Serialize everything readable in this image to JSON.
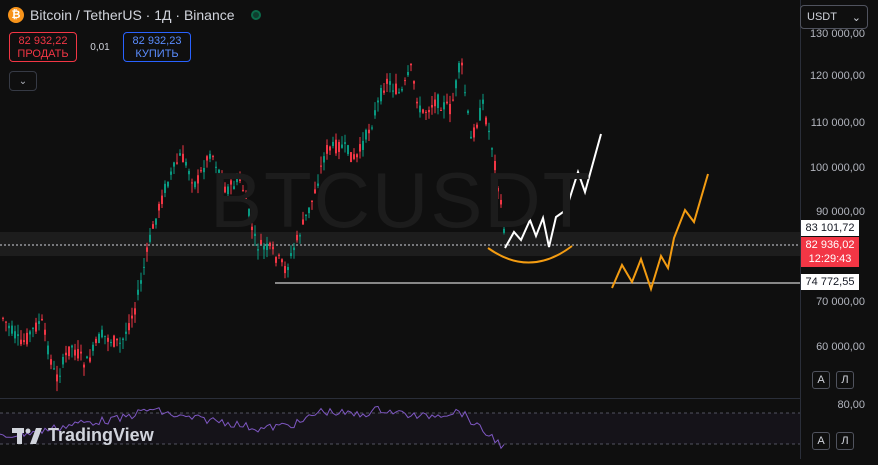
{
  "header": {
    "coin_icon": "₿",
    "title": "Bitcoin / TetherUS · 1Д · Binance"
  },
  "trade": {
    "sell_price": "82 932,22",
    "sell_label": "ПРОДАТЬ",
    "spread": "0,01",
    "buy_price": "82 932,23",
    "buy_label": "КУПИТЬ"
  },
  "currency_select": {
    "value": "USDT",
    "icon": "chevron-down-icon"
  },
  "watermark": "BTCUSDT",
  "price_axis": {
    "labels": [
      "130 000,00",
      "120 000,00",
      "110 000,00",
      "100 000,00",
      "90 000,00",
      "70 000,00",
      "60 000,00"
    ]
  },
  "price_tags": {
    "upper_level": "83 101,72",
    "current_price": "82 936,02",
    "countdown": "12:29:43",
    "lower_level": "74 772,55"
  },
  "rsi": {
    "level": "80,00"
  },
  "buttons": {
    "auto": "А",
    "log": "Л"
  },
  "branding": {
    "logo_text": "TradingView"
  },
  "colors": {
    "up": "#089981",
    "down": "#f23645",
    "forecast_orange": "#f39c12",
    "forecast_white": "#ffffff",
    "rsi": "#7e57c2"
  }
}
